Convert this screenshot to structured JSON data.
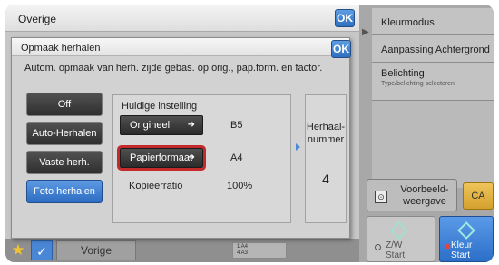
{
  "back_dialog": {
    "title": "Overige",
    "ok_label": "OK",
    "bottom": {
      "star_icon": "★",
      "check_icon": "✓",
      "back_label": "Vorige",
      "page_rows": [
        "1 A4",
        "4 A3"
      ]
    }
  },
  "dialog": {
    "title": "Opmaak herhalen",
    "ok_label": "OK",
    "description": "Autom. opmaak van herh. zijde gebas. op orig., pap.form. en factor.",
    "modes": [
      {
        "label": "Off",
        "active": false
      },
      {
        "label": "Auto-Herhalen",
        "active": false
      },
      {
        "label": "Vaste herh.",
        "active": false
      },
      {
        "label": "Foto herhalen",
        "active": true
      }
    ],
    "current_setting_label": "Huidige instelling",
    "original_label": "Origineel",
    "original_value": "B5",
    "paper_label": "Papierformaat",
    "paper_value": "A4",
    "ratio_label": "Kopieerratio",
    "ratio_value": "100%",
    "arrow_icon": "➜",
    "count_label_line1": "Herhaal-",
    "count_label_line2": "nummer",
    "count_value": "4"
  },
  "right_panel": {
    "items": [
      {
        "label": "Kleurmodus"
      },
      {
        "label": "Aanpassing Achtergrond"
      },
      {
        "label": "Belichting",
        "sub": "Type/belichting selecteren"
      }
    ],
    "preview_line1": "Voorbeeld-",
    "preview_line2": "weergave",
    "ca_label": "CA",
    "bw_start_line1": "Z/W",
    "bw_start_line2": "Start",
    "color_start_line1": "Kleur",
    "color_start_line2": "Start"
  },
  "colors": {
    "accent_blue": "#2d6cc2",
    "ca_yellow": "#d4a12e",
    "focus_red": "#c42a2a"
  }
}
